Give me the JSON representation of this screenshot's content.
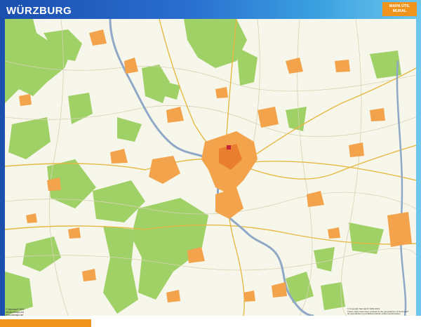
{
  "map": {
    "title": "WÜRZBURG",
    "badge_line1": "MAPA ÚTIL",
    "badge_line2": "MURAL",
    "footer_left_lines": [
      "© Netmaps® 2019",
      "info@netmaps.net",
      "www.netmaps.net"
    ],
    "footer_right_lines": [
      "© Copyright Netmaps® 1983-2019",
      "These maps have been created by the geographers of Netmaps®",
      "Its reproduction is prohibited without written authorization"
    ],
    "colors": {
      "frame": "#1a56b8",
      "land": "#f7f6ea",
      "forest": "#9fd167",
      "river": "#8fa8c8",
      "urban": "#f2a34b",
      "road_major": "#e0c238",
      "accent": "#f0941e"
    }
  }
}
